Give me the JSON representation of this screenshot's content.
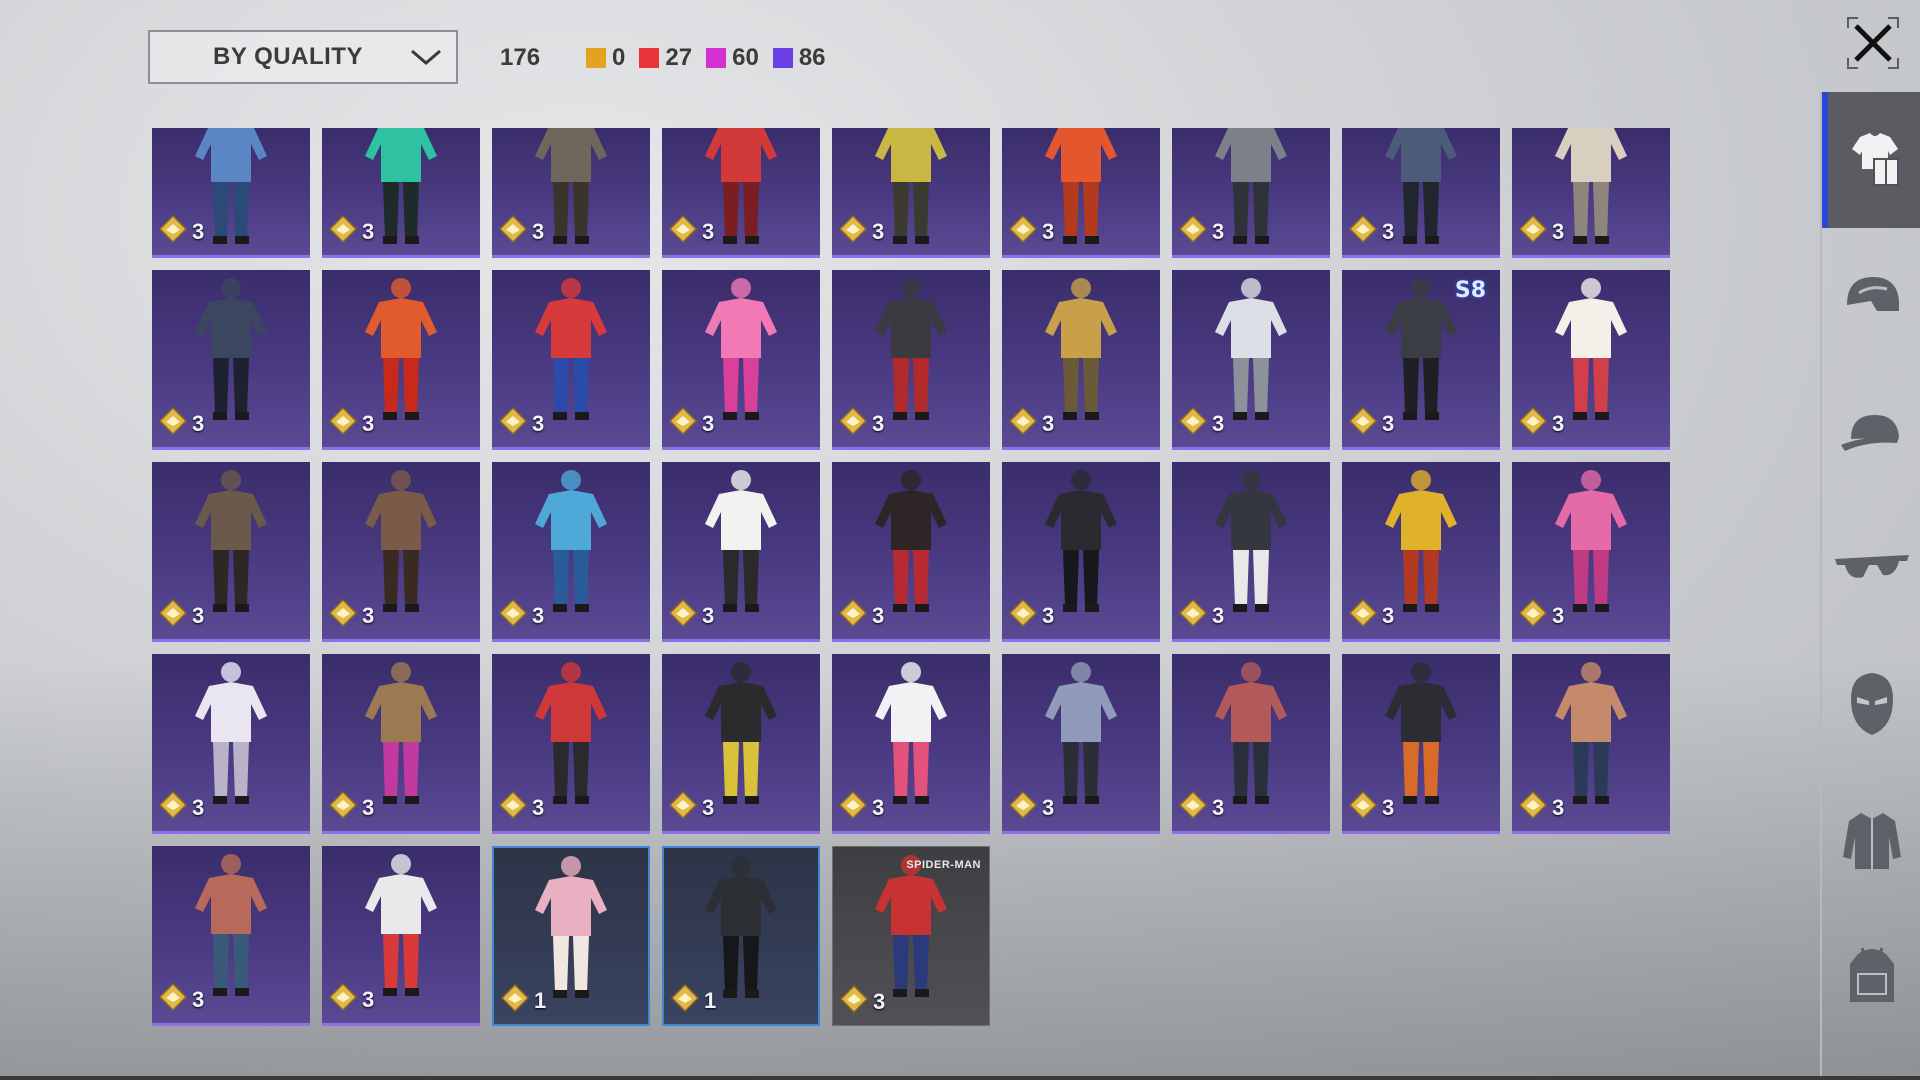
{
  "sort": {
    "label": "BY QUALITY"
  },
  "counts": {
    "total": "176",
    "chips": [
      {
        "color": "#e2a321",
        "value": "0"
      },
      {
        "color": "#e8333a",
        "value": "27"
      },
      {
        "color": "#d42fd0",
        "value": "60"
      },
      {
        "color": "#6a3fe6",
        "value": "86"
      }
    ]
  },
  "icons": {
    "close": "close-icon",
    "currency": "rank-emblem-icon",
    "sidebar": [
      "outfit-icon",
      "helmet-icon",
      "cap-icon",
      "glasses-icon",
      "mask-icon",
      "jacket-icon",
      "backpack-icon"
    ]
  },
  "items": [
    {
      "count": "3",
      "palette": [
        "#5b86c4",
        "#2b4a7a"
      ],
      "style": "purple",
      "row": 0
    },
    {
      "count": "3",
      "palette": [
        "#2fc2a0",
        "#1f2b2a"
      ],
      "style": "purple",
      "row": 0
    },
    {
      "count": "3",
      "palette": [
        "#6f665c",
        "#3a342d"
      ],
      "style": "purple",
      "row": 0
    },
    {
      "count": "3",
      "palette": [
        "#d23a3a",
        "#7a1e22"
      ],
      "style": "purple",
      "row": 0
    },
    {
      "count": "3",
      "palette": [
        "#c9b743",
        "#3b3a30"
      ],
      "style": "purple",
      "row": 0
    },
    {
      "count": "3",
      "palette": [
        "#e4572e",
        "#b33a1c"
      ],
      "style": "purple",
      "row": 0
    },
    {
      "count": "3",
      "palette": [
        "#7c8189",
        "#2f3238"
      ],
      "style": "purple",
      "row": 0
    },
    {
      "count": "3",
      "palette": [
        "#4b5b79",
        "#20252e"
      ],
      "style": "purple",
      "row": 0
    },
    {
      "count": "3",
      "palette": [
        "#d8cfc0",
        "#8e867a"
      ],
      "style": "purple",
      "row": 0
    },
    {
      "count": "3",
      "palette": [
        "#3b4660",
        "#1e2230"
      ],
      "style": "purple",
      "row": 1
    },
    {
      "count": "3",
      "palette": [
        "#e25b2c",
        "#c72a1a"
      ],
      "style": "purple",
      "row": 1
    },
    {
      "count": "3",
      "palette": [
        "#d63a3a",
        "#2c4aa8"
      ],
      "style": "purple",
      "row": 1
    },
    {
      "count": "3",
      "palette": [
        "#f079b6",
        "#d8409a"
      ],
      "style": "purple",
      "row": 1
    },
    {
      "count": "3",
      "palette": [
        "#3a3a40",
        "#b22a2a"
      ],
      "style": "purple",
      "row": 1
    },
    {
      "count": "3",
      "palette": [
        "#c8a04a",
        "#6b5a38"
      ],
      "style": "purple",
      "row": 1
    },
    {
      "count": "3",
      "palette": [
        "#dcdfe6",
        "#8d919a"
      ],
      "style": "purple",
      "row": 1
    },
    {
      "count": "3",
      "palette": [
        "#3a3d44",
        "#1d1f24"
      ],
      "style": "purple",
      "row": 1,
      "tag": "S8"
    },
    {
      "count": "3",
      "palette": [
        "#f3efe9",
        "#d13f4a"
      ],
      "style": "purple",
      "row": 1
    },
    {
      "count": "3",
      "palette": [
        "#6b5a4c",
        "#2e2824"
      ],
      "style": "purple",
      "row": 2
    },
    {
      "count": "3",
      "palette": [
        "#7a5a48",
        "#3a2a22"
      ],
      "style": "purple",
      "row": 2
    },
    {
      "count": "3",
      "palette": [
        "#4ea8d8",
        "#2a5c9a"
      ],
      "style": "purple",
      "row": 2
    },
    {
      "count": "3",
      "palette": [
        "#f2f2f0",
        "#2a2a2a"
      ],
      "style": "purple",
      "row": 2
    },
    {
      "count": "3",
      "palette": [
        "#2e2626",
        "#b82a32"
      ],
      "style": "purple",
      "row": 2
    },
    {
      "count": "3",
      "palette": [
        "#2a2b30",
        "#17181b"
      ],
      "style": "purple",
      "row": 2
    },
    {
      "count": "3",
      "palette": [
        "#34373f",
        "#e8e8e8"
      ],
      "style": "purple",
      "row": 2
    },
    {
      "count": "3",
      "palette": [
        "#e0b22c",
        "#b23a22"
      ],
      "style": "purple",
      "row": 2
    },
    {
      "count": "3",
      "palette": [
        "#e46aa8",
        "#c13a84"
      ],
      "style": "purple",
      "row": 2
    },
    {
      "count": "3",
      "palette": [
        "#e9e6f2",
        "#b8b3c8"
      ],
      "style": "purple",
      "row": 3
    },
    {
      "count": "3",
      "palette": [
        "#9b7a52",
        "#c23aa0"
      ],
      "style": "purple",
      "row": 3
    },
    {
      "count": "3",
      "palette": [
        "#cf3838",
        "#2a2a2c"
      ],
      "style": "purple",
      "row": 3
    },
    {
      "count": "3",
      "palette": [
        "#2b2b2e",
        "#d7c23a"
      ],
      "style": "purple",
      "row": 3
    },
    {
      "count": "3",
      "palette": [
        "#f2f2f4",
        "#e2527a"
      ],
      "style": "purple",
      "row": 3
    },
    {
      "count": "3",
      "palette": [
        "#8f9bb8",
        "#2b2e36"
      ],
      "style": "purple",
      "row": 3
    },
    {
      "count": "3",
      "palette": [
        "#b25a5a",
        "#2a2f3c"
      ],
      "style": "purple",
      "row": 3
    },
    {
      "count": "3",
      "palette": [
        "#2b2d33",
        "#d86a2a"
      ],
      "style": "purple",
      "row": 3
    },
    {
      "count": "3",
      "palette": [
        "#c48a6a",
        "#2a3a58"
      ],
      "style": "purple",
      "row": 3
    },
    {
      "count": "3",
      "palette": [
        "#b86a5a",
        "#3a5a7a"
      ],
      "style": "purple",
      "row": 4
    },
    {
      "count": "3",
      "palette": [
        "#e9e9ec",
        "#d83a3a"
      ],
      "style": "purple",
      "row": 4
    },
    {
      "count": "1",
      "palette": [
        "#e8b0c2",
        "#f0e8e0"
      ],
      "style": "blue",
      "row": 4
    },
    {
      "count": "1",
      "palette": [
        "#2c3034",
        "#15171a"
      ],
      "style": "blue",
      "row": 4
    },
    {
      "count": "3",
      "palette": [
        "#c83232",
        "#2a3a7a"
      ],
      "style": "gray",
      "row": 4,
      "tag": "SPIDER-MAN"
    }
  ]
}
